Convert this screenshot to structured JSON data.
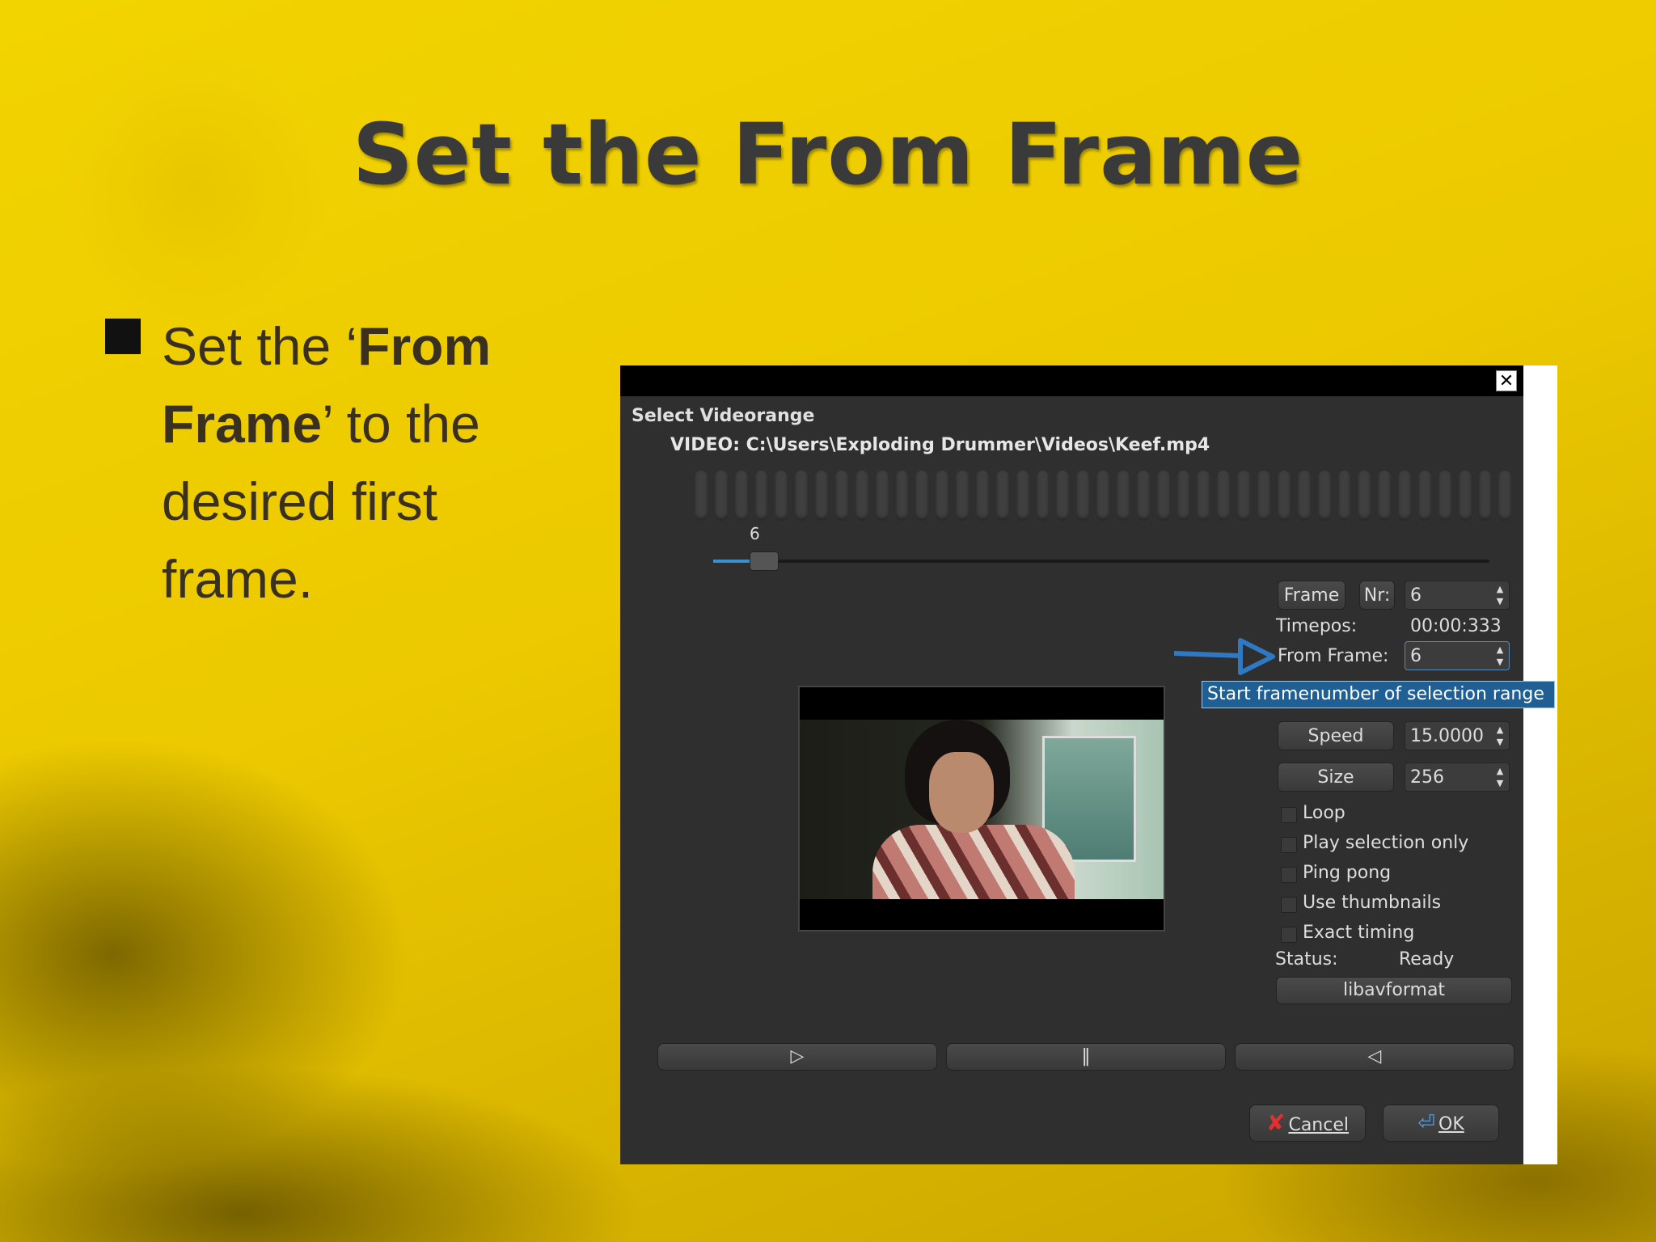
{
  "slide": {
    "title": "Set the From Frame",
    "bullet": {
      "part1": "Set the ‘",
      "bold1": "From Frame",
      "part2": "’ to the desired first frame."
    }
  },
  "dialog": {
    "close_glyph": "✕",
    "heading": "Select Videorange",
    "video_path": "VIDEO: C:\\Users\\Exploding Drummer\\Videos\\Keef.mp4",
    "slider_value": "6",
    "slider_progress": 0.01,
    "frame_button": "Frame",
    "nr_button": "Nr:",
    "frame_nr_value": "6",
    "timepos_label": "Timepos:",
    "timepos_value": "00:00:333",
    "from_frame_label": "From Frame:",
    "from_frame_value": "6",
    "tooltip": "Start framenumber of selection range",
    "speed_button": "Speed",
    "speed_value": "15.0000",
    "size_button": "Size",
    "size_value": "256",
    "checkboxes": [
      {
        "label": "Loop",
        "checked": false
      },
      {
        "label": "Play selection only",
        "checked": false
      },
      {
        "label": "Ping pong",
        "checked": false
      },
      {
        "label": "Use thumbnails",
        "checked": false
      },
      {
        "label": "Exact timing",
        "checked": false
      }
    ],
    "status_label": "Status:",
    "status_value": "Ready",
    "backend_button": "libavformat",
    "transport": {
      "play": "▷",
      "pause": "‖",
      "play_reverse": "◁"
    },
    "cancel_label": "Cancel",
    "ok_label": "OK",
    "spin_arrows": "▲\n▼"
  }
}
